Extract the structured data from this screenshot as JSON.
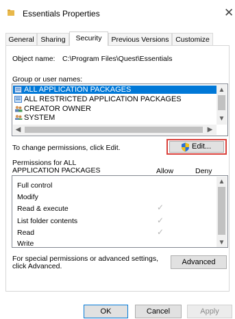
{
  "window": {
    "title": "Essentials Properties",
    "close_glyph": "✕"
  },
  "tabs": [
    {
      "label": "General"
    },
    {
      "label": "Sharing"
    },
    {
      "label": "Security"
    },
    {
      "label": "Previous Versions"
    },
    {
      "label": "Customize"
    }
  ],
  "security": {
    "object_name_label": "Object name:",
    "object_name_value": "C:\\Program Files\\Quest\\Essentials",
    "groups_label": "Group or user names:",
    "groups": [
      {
        "name": "ALL APPLICATION PACKAGES",
        "icon": "app-packages-icon",
        "selected": true
      },
      {
        "name": "ALL RESTRICTED APPLICATION PACKAGES",
        "icon": "app-packages-icon",
        "selected": false
      },
      {
        "name": "CREATOR OWNER",
        "icon": "users-icon",
        "selected": false
      },
      {
        "name": "SYSTEM",
        "icon": "users-icon",
        "selected": false
      }
    ],
    "change_text": "To change permissions, click Edit.",
    "edit_label": "Edit...",
    "permissions_for_line1": "Permissions for ALL",
    "permissions_for_line2": "APPLICATION PACKAGES",
    "allow_header": "Allow",
    "deny_header": "Deny",
    "permissions": [
      {
        "name": "Full control",
        "allow": false,
        "deny": false
      },
      {
        "name": "Modify",
        "allow": false,
        "deny": false
      },
      {
        "name": "Read & execute",
        "allow": true,
        "deny": false
      },
      {
        "name": "List folder contents",
        "allow": true,
        "deny": false
      },
      {
        "name": "Read",
        "allow": true,
        "deny": false
      },
      {
        "name": "Write",
        "allow": false,
        "deny": false
      }
    ],
    "special_line1": "For special permissions or advanced settings,",
    "special_line2": "click Advanced.",
    "advanced_label": "Advanced"
  },
  "buttons": {
    "ok": "OK",
    "cancel": "Cancel",
    "apply": "Apply"
  },
  "colors": {
    "selection": "#0078d7",
    "highlight_box": "#d9403a",
    "shield_blue": "#2a6fd6",
    "shield_yellow": "#f2c318"
  }
}
